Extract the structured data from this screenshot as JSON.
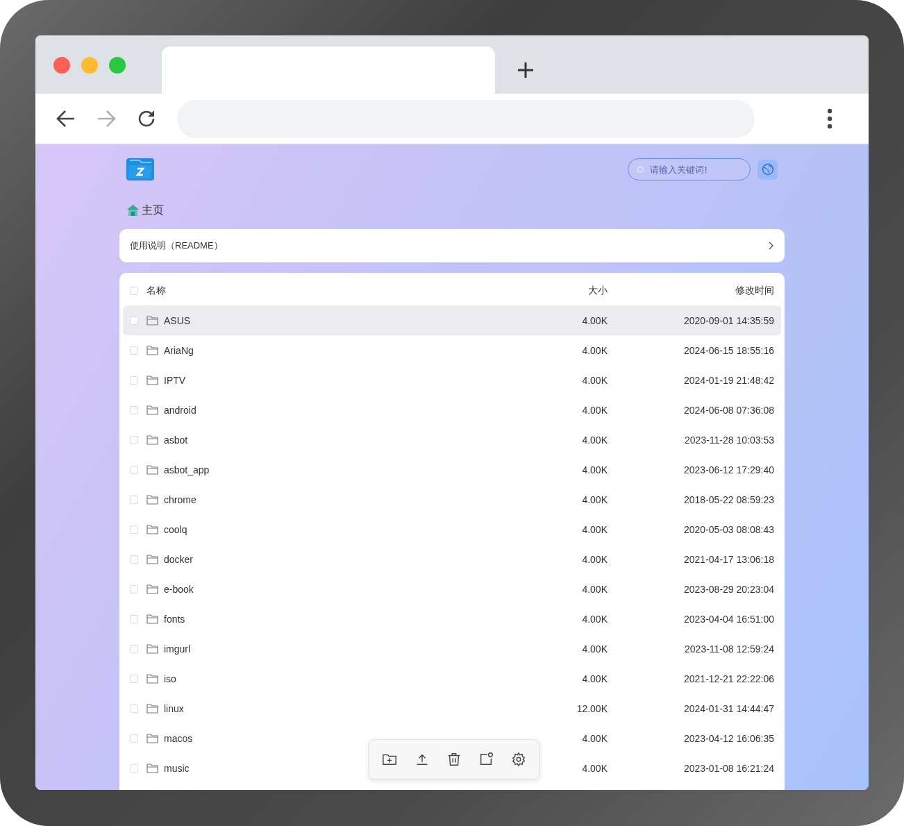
{
  "browser": {
    "forward_disabled": true
  },
  "search": {
    "placeholder": "请输入关键词!"
  },
  "breadcrumb": [
    {
      "label": "主页"
    }
  ],
  "readme": {
    "label": "使用说明（README）"
  },
  "table": {
    "all_checked": false,
    "columns": [
      "名称",
      "大小",
      "修改时间"
    ],
    "rows": [
      {
        "name": "ASUS",
        "size": "4.00K",
        "modified": "2020-09-01 14:35:59",
        "checked": false,
        "highlighted": true
      },
      {
        "name": "AriaNg",
        "size": "4.00K",
        "modified": "2024-06-15 18:55:16",
        "checked": false,
        "highlighted": false
      },
      {
        "name": "IPTV",
        "size": "4.00K",
        "modified": "2024-01-19 21:48:42",
        "checked": false,
        "highlighted": false
      },
      {
        "name": "android",
        "size": "4.00K",
        "modified": "2024-06-08 07:36:08",
        "checked": false,
        "highlighted": false
      },
      {
        "name": "asbot",
        "size": "4.00K",
        "modified": "2023-11-28 10:03:53",
        "checked": false,
        "highlighted": false
      },
      {
        "name": "asbot_app",
        "size": "4.00K",
        "modified": "2023-06-12 17:29:40",
        "checked": false,
        "highlighted": false
      },
      {
        "name": "chrome",
        "size": "4.00K",
        "modified": "2018-05-22 08:59:23",
        "checked": false,
        "highlighted": false
      },
      {
        "name": "coolq",
        "size": "4.00K",
        "modified": "2020-05-03 08:08:43",
        "checked": false,
        "highlighted": false
      },
      {
        "name": "docker",
        "size": "4.00K",
        "modified": "2021-04-17 13:06:18",
        "checked": false,
        "highlighted": false
      },
      {
        "name": "e-book",
        "size": "4.00K",
        "modified": "2023-08-29 20:23:04",
        "checked": false,
        "highlighted": false
      },
      {
        "name": "fonts",
        "size": "4.00K",
        "modified": "2023-04-04 16:51:00",
        "checked": false,
        "highlighted": false
      },
      {
        "name": "imgurl",
        "size": "4.00K",
        "modified": "2023-11-08 12:59:24",
        "checked": false,
        "highlighted": false
      },
      {
        "name": "iso",
        "size": "4.00K",
        "modified": "2021-12-21 22:22:06",
        "checked": false,
        "highlighted": false
      },
      {
        "name": "linux",
        "size": "12.00K",
        "modified": "2024-01-31 14:44:47",
        "checked": false,
        "highlighted": false
      },
      {
        "name": "macos",
        "size": "4.00K",
        "modified": "2023-04-12 16:06:35",
        "checked": false,
        "highlighted": false
      },
      {
        "name": "music",
        "size": "4.00K",
        "modified": "2023-01-08 16:21:24",
        "checked": false,
        "highlighted": false
      }
    ]
  }
}
